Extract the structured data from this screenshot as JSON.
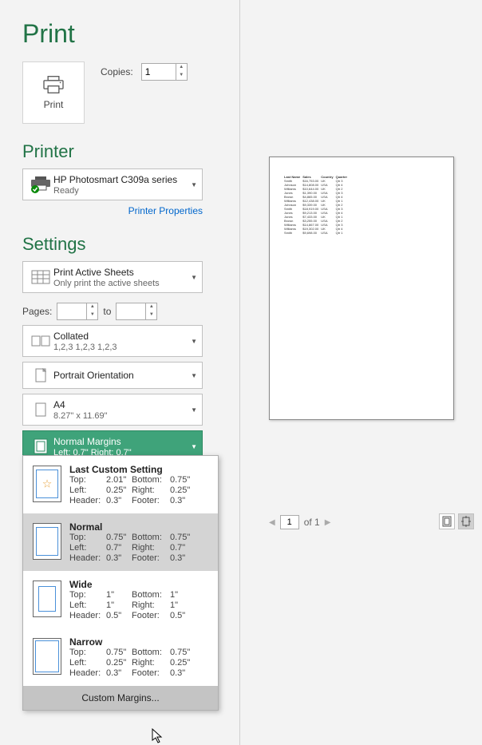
{
  "title": "Print",
  "print_button_label": "Print",
  "copies": {
    "label": "Copies:",
    "value": "1"
  },
  "printer_heading": "Printer",
  "printer": {
    "name": "HP Photosmart C309a series",
    "status": "Ready"
  },
  "printer_properties_link": "Printer Properties",
  "settings_heading": "Settings",
  "pages": {
    "label": "Pages:",
    "to": "to",
    "from": "",
    "to_value": ""
  },
  "setting_sheets": {
    "l1": "Print Active Sheets",
    "l2": "Only print the active sheets"
  },
  "setting_collate": {
    "l1": "Collated",
    "l2": "1,2,3    1,2,3    1,2,3"
  },
  "setting_orientation": {
    "l1": "Portrait Orientation"
  },
  "setting_paper": {
    "l1": "A4",
    "l2": "8.27\" x 11.69\""
  },
  "setting_margin": {
    "l1": "Normal Margins",
    "l2": "Left:  0.7\"    Right:  0.7\""
  },
  "margin_options": [
    {
      "name": "Last Custom Setting",
      "top": "2.01\"",
      "bottom": "0.75\"",
      "left": "0.25\"",
      "right": "0.25\"",
      "header": "0.3\"",
      "footer": "0.3\"",
      "star": true
    },
    {
      "name": "Normal",
      "top": "0.75\"",
      "bottom": "0.75\"",
      "left": "0.7\"",
      "right": "0.7\"",
      "header": "0.3\"",
      "footer": "0.3\"",
      "selected": true
    },
    {
      "name": "Wide",
      "top": "1\"",
      "bottom": "1\"",
      "left": "1\"",
      "right": "1\"",
      "header": "0.5\"",
      "footer": "0.5\""
    },
    {
      "name": "Narrow",
      "top": "0.75\"",
      "bottom": "0.75\"",
      "left": "0.25\"",
      "right": "0.25\"",
      "header": "0.3\"",
      "footer": "0.3\""
    }
  ],
  "margin_labels": {
    "top": "Top:",
    "bottom": "Bottom:",
    "left": "Left:",
    "right": "Right:",
    "header": "Header:",
    "footer": "Footer:"
  },
  "custom_margins_label": "Custom Margins...",
  "pager": {
    "current": "1",
    "of": "of 1"
  },
  "preview_headers": [
    "Last Name",
    "Sales",
    "Country",
    "Quarter"
  ],
  "preview_rows": [
    [
      "Smith",
      "$16,753.00",
      "UK",
      "Qtr 3"
    ],
    [
      "Johnson",
      "$14,808.00",
      "USA",
      "Qtr 4"
    ],
    [
      "Williams",
      "$10,644.00",
      "UK",
      "Qtr 2"
    ],
    [
      "Jones",
      "$1,390.00",
      "USA",
      "Qtr 3"
    ],
    [
      "Brown",
      "$4,865.00",
      "USA",
      "Qtr 4"
    ],
    [
      "Williams",
      "$12,438.00",
      "UK",
      "Qtr 1"
    ],
    [
      "Johnson",
      "$9,339.00",
      "UK",
      "Qtr 2"
    ],
    [
      "Smith",
      "$18,919.00",
      "USA",
      "Qtr 3"
    ],
    [
      "Jones",
      "$9,213.00",
      "USA",
      "Qtr 4"
    ],
    [
      "Jones",
      "$7,433.00",
      "UK",
      "Qtr 1"
    ],
    [
      "Brown",
      "$3,255.00",
      "USA",
      "Qtr 2"
    ],
    [
      "Williams",
      "$14,867.00",
      "USA",
      "Qtr 3"
    ],
    [
      "Williams",
      "$19,302.00",
      "UK",
      "Qtr 4"
    ],
    [
      "Smith",
      "$9,698.00",
      "USA",
      "Qtr 1"
    ]
  ]
}
